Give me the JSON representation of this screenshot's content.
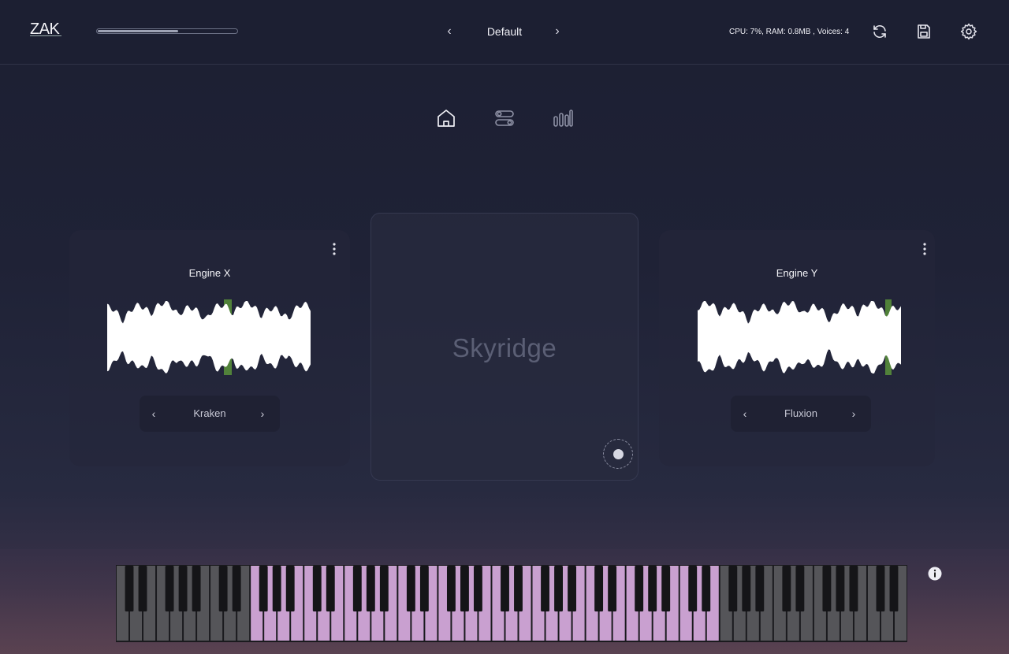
{
  "header": {
    "logo": "ZAK",
    "progress": 0.58,
    "preset_name": "Default",
    "stats": "CPU: 7%, RAM: 0.8MB , Voices: 4",
    "icons": [
      "refresh-icon",
      "save-icon",
      "settings-icon"
    ]
  },
  "nav": {
    "tabs": [
      "home-icon",
      "sliders-icon",
      "equalizer-icon"
    ],
    "active_tab": "home-icon"
  },
  "engines": {
    "left": {
      "title": "Engine X",
      "sample": "Kraken"
    },
    "right": {
      "title": "Engine Y",
      "sample": "Fluxion"
    }
  },
  "pad": {
    "title": "Skyridge"
  },
  "keyboard": {
    "white_key_color": "#555559",
    "black_key_color": "#151518",
    "active_color": "#c9a0d0",
    "active_white_start": 10,
    "active_white_end": 45,
    "total_white_keys": 59
  },
  "colors": {
    "accent_green": "#6fbf3a",
    "wave": "#ffffff"
  }
}
